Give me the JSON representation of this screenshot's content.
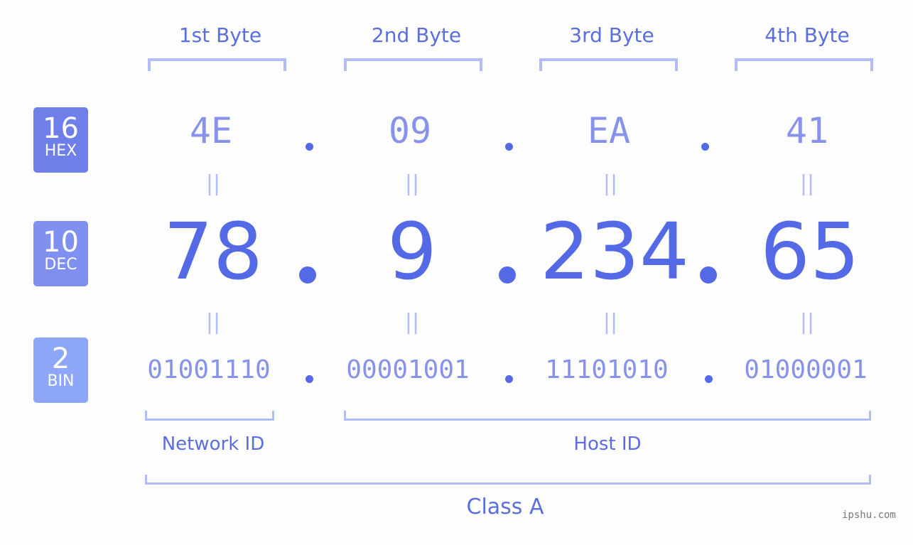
{
  "bytes": [
    {
      "label": "1st Byte",
      "hex": "4E",
      "dec": "78",
      "bin": "01001110"
    },
    {
      "label": "2nd Byte",
      "hex": "09",
      "dec": "9",
      "bin": "00001001"
    },
    {
      "label": "3rd Byte",
      "hex": "EA",
      "dec": "234",
      "bin": "11101010"
    },
    {
      "label": "4th Byte",
      "hex": "41",
      "dec": "65",
      "bin": "01000001"
    }
  ],
  "badges": {
    "hex": {
      "num": "16",
      "label": "HEX",
      "color": "#6e7fe9"
    },
    "dec": {
      "num": "10",
      "label": "DEC",
      "color": "#8090f0"
    },
    "bin": {
      "num": "2",
      "label": "BIN",
      "color": "#8ea6f8"
    }
  },
  "separator": ".",
  "equals": "||",
  "parts": {
    "network": "Network ID",
    "host": "Host ID",
    "class": "Class A"
  },
  "watermark": "ipshu.com"
}
